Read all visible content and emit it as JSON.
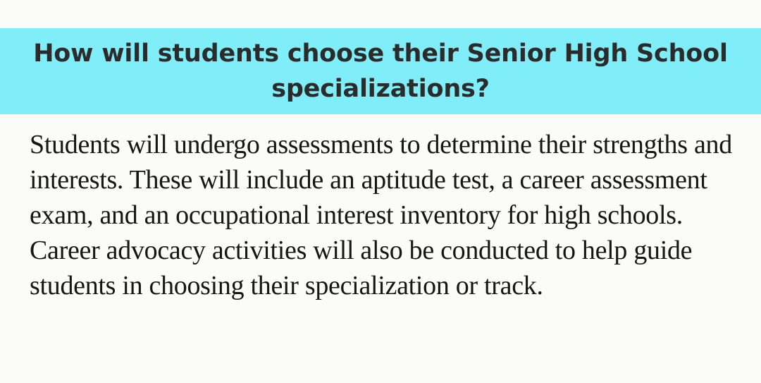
{
  "heading": {
    "text": "How will students choose their Senior High School specializations?",
    "background_color": "#80eef8"
  },
  "answer": {
    "text": "Students will undergo assessments to determine their strengths and interests. These will include an aptitude test, a career assessment exam, and an occupational interest inventory for high schools. Career advocacy activities will also be conducted to help guide students in choosing their specialization or track."
  }
}
